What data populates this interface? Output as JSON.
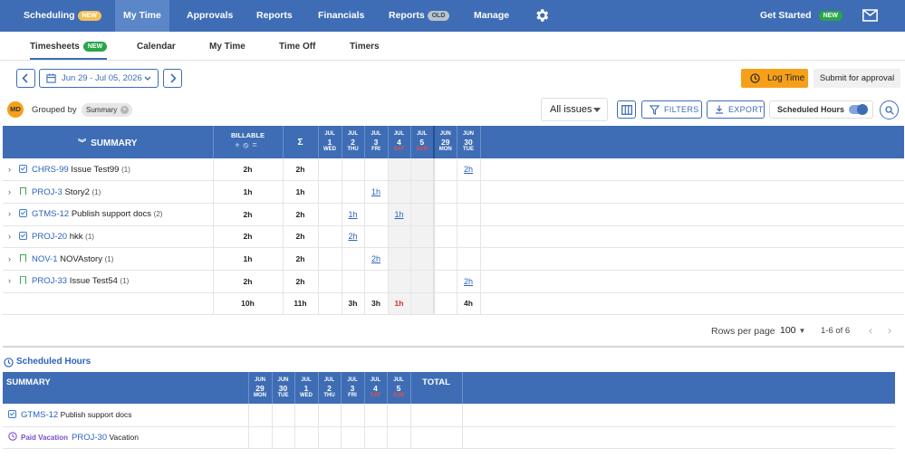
{
  "nav": {
    "scheduling": "Scheduling",
    "scheduling_badge": "NEW",
    "mytime": "My Time",
    "approvals": "Approvals",
    "reports": "Reports",
    "financials": "Financials",
    "reports_old": "Reports",
    "reports_old_badge": "OLD",
    "manage": "Manage",
    "get_started": "Get Started",
    "get_started_badge": "NEW",
    "settings_icon": "gear-icon",
    "mail_icon": "mail-icon",
    "colors": {
      "bar": "#3e6db5",
      "active": "#5b87c9"
    }
  },
  "subtabs": {
    "timesheets": "Timesheets",
    "timesheets_badge": "NEW",
    "calendar": "Calendar",
    "mytime": "My Time",
    "timeoff": "Time Off",
    "timers": "Timers"
  },
  "toolbar": {
    "date_range": "Jun 29 - Jul 05, 2026",
    "log_time": "Log Time",
    "submit": "Submit for approval",
    "avatar": "MD",
    "grouped_by": "Grouped by",
    "group_chip": "Summary",
    "issues_select": "All issues",
    "filters": "FILTERS",
    "export": "EXPORT",
    "scheduled_hours": "Scheduled Hours",
    "scheduled_hours_on": true
  },
  "grid": {
    "header": {
      "summary": "SUMMARY",
      "billable": "BILLABLE",
      "sigma": "Σ",
      "days": [
        {
          "m": "JUL",
          "d": "1",
          "w": "WED",
          "weekend": false
        },
        {
          "m": "JUL",
          "d": "2",
          "w": "THU",
          "weekend": false
        },
        {
          "m": "JUL",
          "d": "3",
          "w": "FRI",
          "weekend": false
        },
        {
          "m": "JUL",
          "d": "4",
          "w": "SAT",
          "weekend": true
        },
        {
          "m": "JUL",
          "d": "5",
          "w": "SUN",
          "weekend": true
        },
        {
          "m": "JUN",
          "d": "29",
          "w": "MON",
          "weekend": false
        },
        {
          "m": "JUN",
          "d": "30",
          "w": "TUE",
          "weekend": false
        }
      ]
    },
    "rows": [
      {
        "icon": "check",
        "key": "CHRS-99",
        "title": "Issue Test99",
        "count": "(1)",
        "billable": "2h",
        "total": "2h",
        "days": [
          "",
          "",
          "",
          "",
          "",
          "",
          "2h"
        ]
      },
      {
        "icon": "bookmark",
        "key": "PROJ-3",
        "title": "Story2",
        "count": "(1)",
        "billable": "1h",
        "total": "1h",
        "days": [
          "",
          "",
          "1h",
          "",
          "",
          "",
          ""
        ]
      },
      {
        "icon": "check",
        "key": "GTMS-12",
        "title": "Publish support docs",
        "count": "(2)",
        "billable": "2h",
        "total": "2h",
        "days": [
          "",
          "1h",
          "",
          "1h",
          "",
          "",
          ""
        ]
      },
      {
        "icon": "check",
        "key": "PROJ-20",
        "title": "hkk",
        "count": "(1)",
        "billable": "2h",
        "total": "2h",
        "days": [
          "",
          "2h",
          "",
          "",
          "",
          "",
          ""
        ]
      },
      {
        "icon": "bookmark",
        "key": "NOV-1",
        "title": "NOVAstory",
        "count": "(1)",
        "billable": "1h",
        "total": "2h",
        "days": [
          "",
          "",
          "2h",
          "",
          "",
          "",
          ""
        ]
      },
      {
        "icon": "bookmark",
        "key": "PROJ-33",
        "title": "Issue Test54",
        "count": "(1)",
        "billable": "2h",
        "total": "2h",
        "days": [
          "",
          "",
          "",
          "",
          "",
          "",
          "2h"
        ]
      }
    ],
    "totals": {
      "billable": "10h",
      "total": "11h",
      "days": [
        "",
        "3h",
        "3h",
        "1h",
        "",
        "",
        "4h"
      ]
    }
  },
  "pagination": {
    "rows_per_page_label": "Rows per page",
    "rows_per_page": "100",
    "range": "1-6 of 6"
  },
  "scheduled": {
    "title": "Scheduled Hours",
    "header": {
      "summary": "SUMMARY",
      "total": "TOTAL",
      "days": [
        {
          "m": "JUN",
          "d": "29",
          "w": "MON",
          "weekend": false
        },
        {
          "m": "JUN",
          "d": "30",
          "w": "TUE",
          "weekend": false
        },
        {
          "m": "JUL",
          "d": "1",
          "w": "WED",
          "weekend": false
        },
        {
          "m": "JUL",
          "d": "2",
          "w": "THU",
          "weekend": false
        },
        {
          "m": "JUL",
          "d": "3",
          "w": "FRI",
          "weekend": false
        },
        {
          "m": "JUL",
          "d": "4",
          "w": "SAT",
          "weekend": true
        },
        {
          "m": "JUL",
          "d": "5",
          "w": "SUN",
          "weekend": true
        }
      ]
    },
    "rows": [
      {
        "tag": "",
        "key": "GTMS-12",
        "title": "Publish support docs"
      },
      {
        "tag": "Paid Vacation",
        "key": "PROJ-30",
        "title": "Vacation"
      }
    ]
  }
}
